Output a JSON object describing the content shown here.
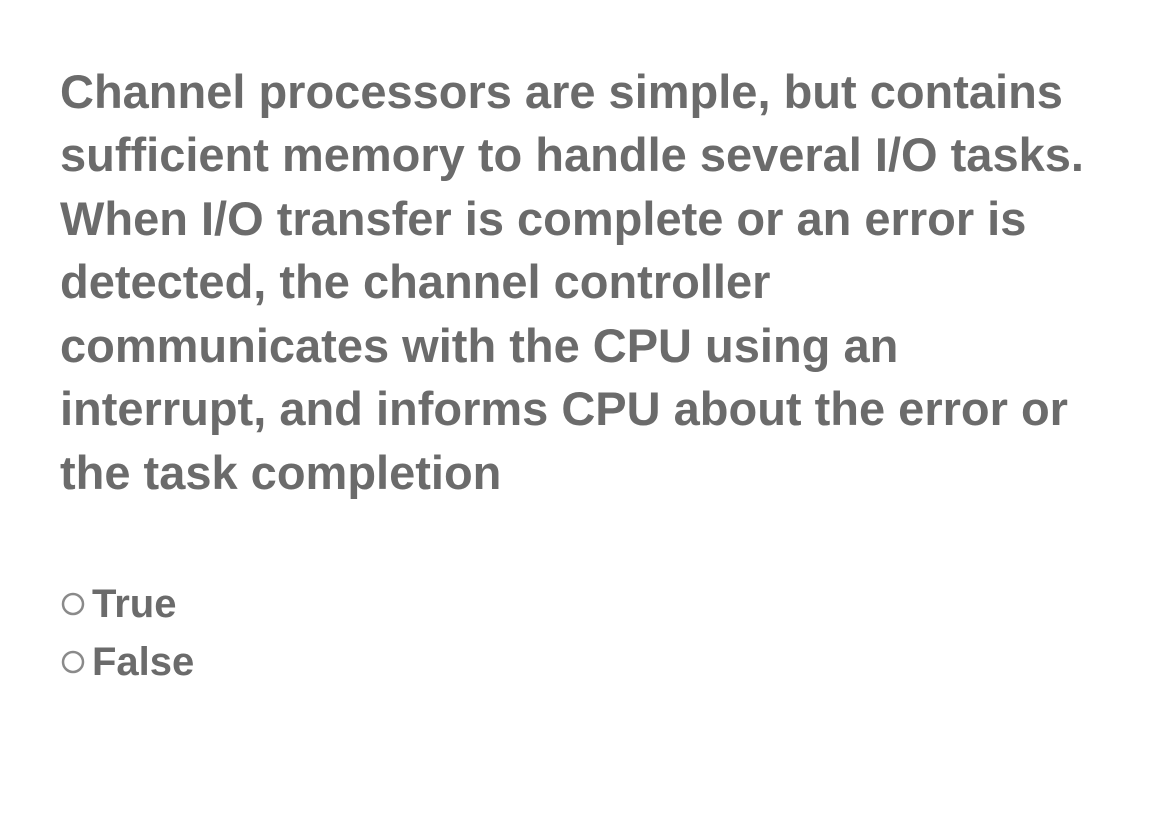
{
  "question": {
    "text": "Channel processors are simple, but contains sufficient memory to handle several I/O tasks. When I/O transfer is complete or an error is detected, the channel controller communicates with the CPU using an interrupt, and informs CPU about the error or the task completion"
  },
  "options": [
    {
      "label": "True",
      "selected": false
    },
    {
      "label": "False",
      "selected": false
    }
  ]
}
